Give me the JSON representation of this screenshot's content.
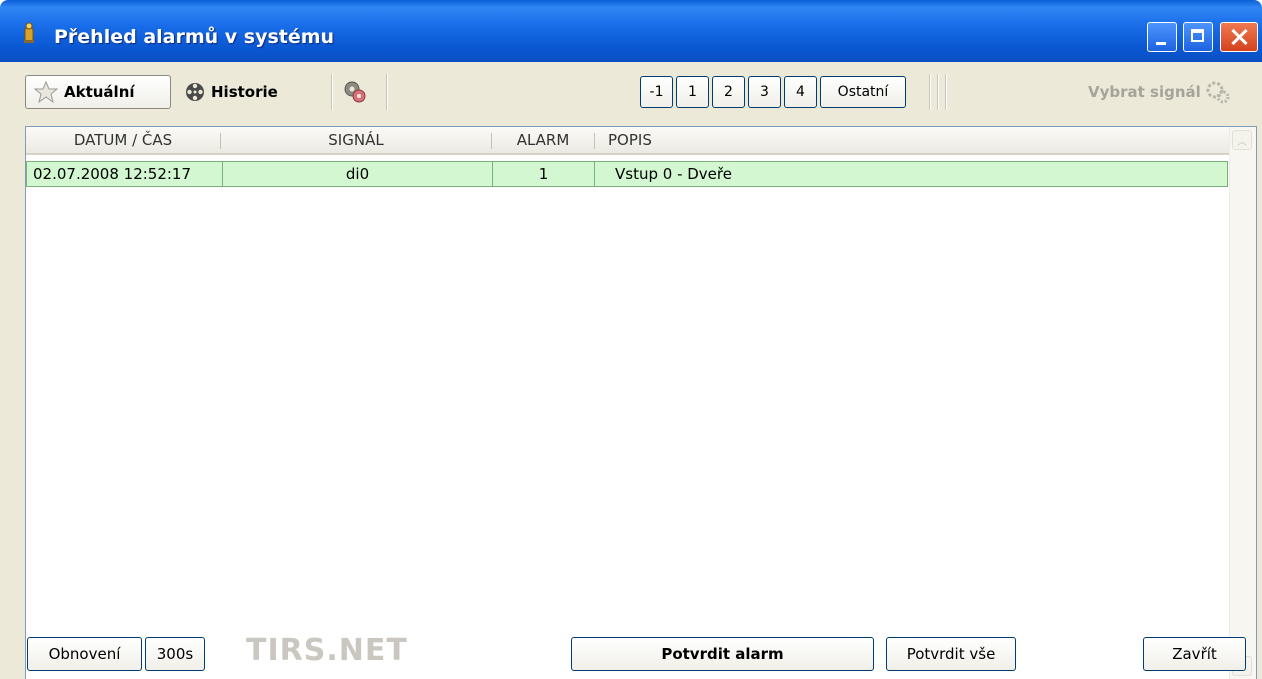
{
  "window": {
    "title": "Přehled alarmů v systému",
    "icons": {
      "app": "alarm-bell-icon",
      "minimize": "minimize-icon",
      "maximize": "maximize-icon",
      "close": "close-icon"
    },
    "colors": {
      "titlebar": "#0b58d3",
      "row_highlight": "#d3f7d0",
      "close_button": "#d4421c"
    }
  },
  "toolbar": {
    "tab_current": {
      "label": "Aktuální",
      "icon": "star-icon"
    },
    "tab_history": {
      "label": "Historie",
      "icon": "film-reel-icon"
    },
    "settings_icon": "gear-filter-icon",
    "levels": [
      "-1",
      "1",
      "2",
      "3",
      "4",
      "Ostatní"
    ],
    "select_signal": {
      "label": "Vybrat signál",
      "icon": "gears-icon"
    }
  },
  "table": {
    "columns": [
      "DATUM / ČAS",
      "SIGNÁL",
      "ALARM",
      "POPIS"
    ],
    "rows": [
      {
        "datetime": "02.07.2008 12:52:17",
        "signal": "di0",
        "alarm": "1",
        "description": "Vstup 0 - Dveře"
      }
    ]
  },
  "footer": {
    "refresh_label": "Obnovení",
    "interval_label": "300s",
    "logo_text": "TIRS.NET",
    "confirm_alarm_label": "Potvrdit alarm",
    "confirm_all_label": "Potvrdit vše",
    "close_label": "Zavřít"
  }
}
